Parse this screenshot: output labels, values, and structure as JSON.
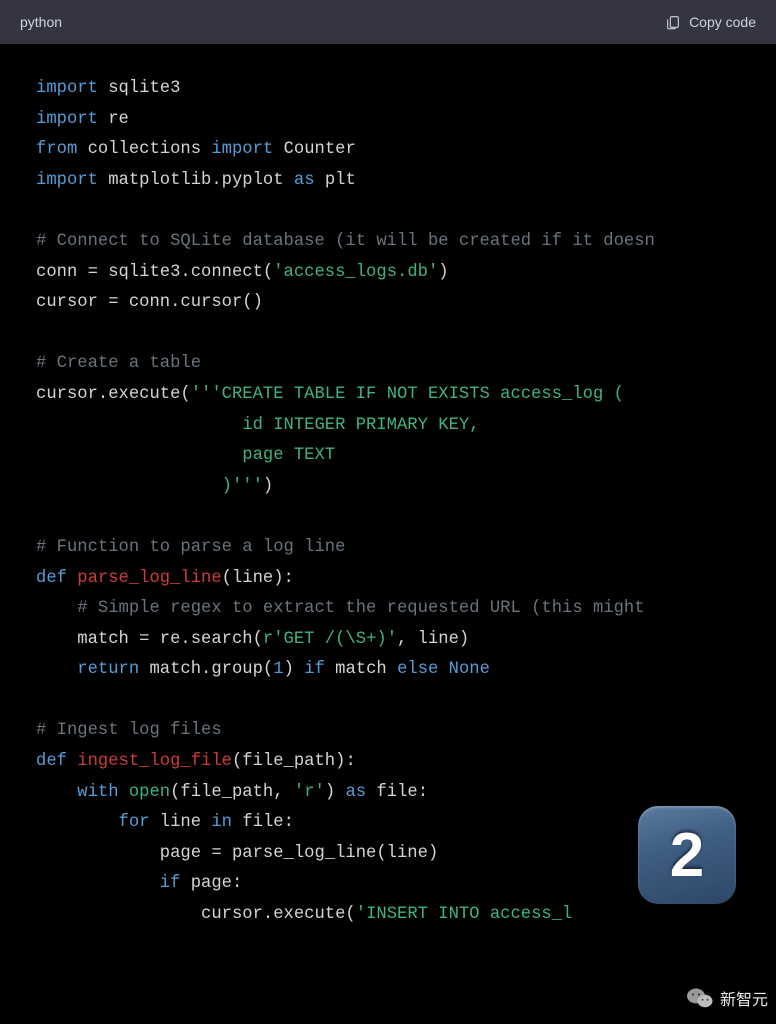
{
  "header": {
    "language": "python",
    "copy_label": "Copy code"
  },
  "code": {
    "l1_kw1": "import",
    "l1_mod": " sqlite3",
    "l2_kw1": "import",
    "l2_mod": " re",
    "l3_kw1": "from",
    "l3_mod": " collections ",
    "l3_kw2": "import",
    "l3_mod2": " Counter",
    "l4_kw1": "import",
    "l4_mod": " matplotlib.pyplot ",
    "l4_kw2": "as",
    "l4_mod2": " plt",
    "l6_cmt": "# Connect to SQLite database (it will be created if it doesn",
    "l7_a": "conn = sqlite3.connect(",
    "l7_str": "'access_logs.db'",
    "l7_c": ")",
    "l8": "cursor = conn.cursor()",
    "l10_cmt": "# Create a table",
    "l11_a": "cursor.execute(",
    "l11_str": "'''CREATE TABLE IF NOT EXISTS access_log (",
    "l12_str": "                    id INTEGER PRIMARY KEY,",
    "l13_str": "                    page TEXT",
    "l14_str": "                  )'''",
    "l14_c": ")",
    "l16_cmt": "# Function to parse a log line",
    "l17_kw": "def",
    "l17_fn": " parse_log_line",
    "l17_p": "(line):",
    "l18_cmt": "    # Simple regex to extract the requested URL (this might ",
    "l19_a": "    match = re.search(",
    "l19_str": "r'GET /(\\S+)'",
    "l19_b": ", line)",
    "l20_kw1": "    return",
    "l20_a": " match.group(",
    "l20_num": "1",
    "l20_b": ") ",
    "l20_kw2": "if",
    "l20_c": " match ",
    "l20_kw3": "else",
    "l20_d": " None",
    "l22_cmt": "# Ingest log files",
    "l23_kw": "def",
    "l23_fn": " ingest_log_file",
    "l23_p": "(file_path):",
    "l24_kw1": "    with",
    "l24_b": " ",
    "l24_open": "open",
    "l24_a": "(file_path, ",
    "l24_str": "'r'",
    "l24_c": ") ",
    "l24_kw2": "as",
    "l24_d": " file:",
    "l25_kw1": "        for",
    "l25_a": " line ",
    "l25_kw2": "in",
    "l25_b": " file:",
    "l26": "            page = parse_log_line(line)",
    "l27_kw": "            if",
    "l27_a": " page:",
    "l28_a": "                cursor.execute(",
    "l28_str": "'INSERT INTO access_l"
  },
  "badge": {
    "number": "2"
  },
  "watermark": {
    "text": "新智元"
  }
}
